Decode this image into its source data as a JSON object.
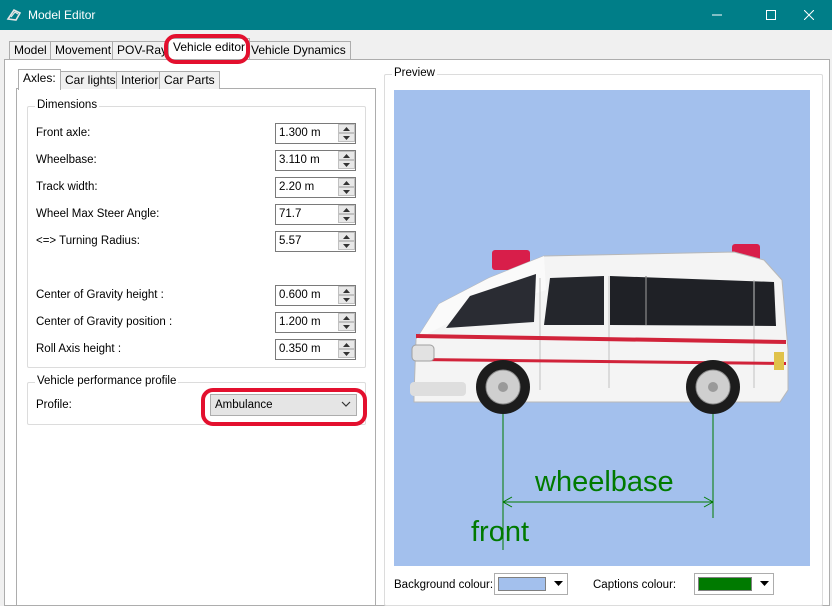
{
  "window": {
    "title": "Model Editor"
  },
  "main_tabs": [
    "Model",
    "Movement",
    "POV-Ray",
    "Vehicle editor",
    "Vehicle Dynamics"
  ],
  "sub_tabs": [
    "Axles:",
    "Car lights",
    "Interior",
    "Car Parts"
  ],
  "dimensions": {
    "legend": "Dimensions",
    "fields": [
      {
        "label": "Front axle:",
        "value": "1.300 m"
      },
      {
        "label": "Wheelbase:",
        "value": "3.110 m"
      },
      {
        "label": "Track width:",
        "value": "2.20 m"
      },
      {
        "label": "Wheel Max Steer Angle:",
        "value": "71.7"
      },
      {
        "label": "<=> Turning Radius:",
        "value": "5.57"
      },
      {
        "label": "Center of Gravity height :",
        "value": "0.600 m"
      },
      {
        "label": "Center of Gravity position :",
        "value": "1.200 m"
      },
      {
        "label": "Roll Axis height :",
        "value": "0.350 m"
      }
    ]
  },
  "performance": {
    "legend": "Vehicle performance profile",
    "profile_label": "Profile:",
    "profile_value": "Ambulance"
  },
  "preview": {
    "legend": "Preview",
    "wheelbase_caption": "wheelbase",
    "front_caption": "front",
    "background_label": "Background colour:",
    "captions_label": "Captions colour:",
    "background_color": "#a3c0ed",
    "captions_color": "#007a00"
  },
  "colors": {
    "titlebar": "#007e88",
    "highlight": "#e3102e"
  }
}
